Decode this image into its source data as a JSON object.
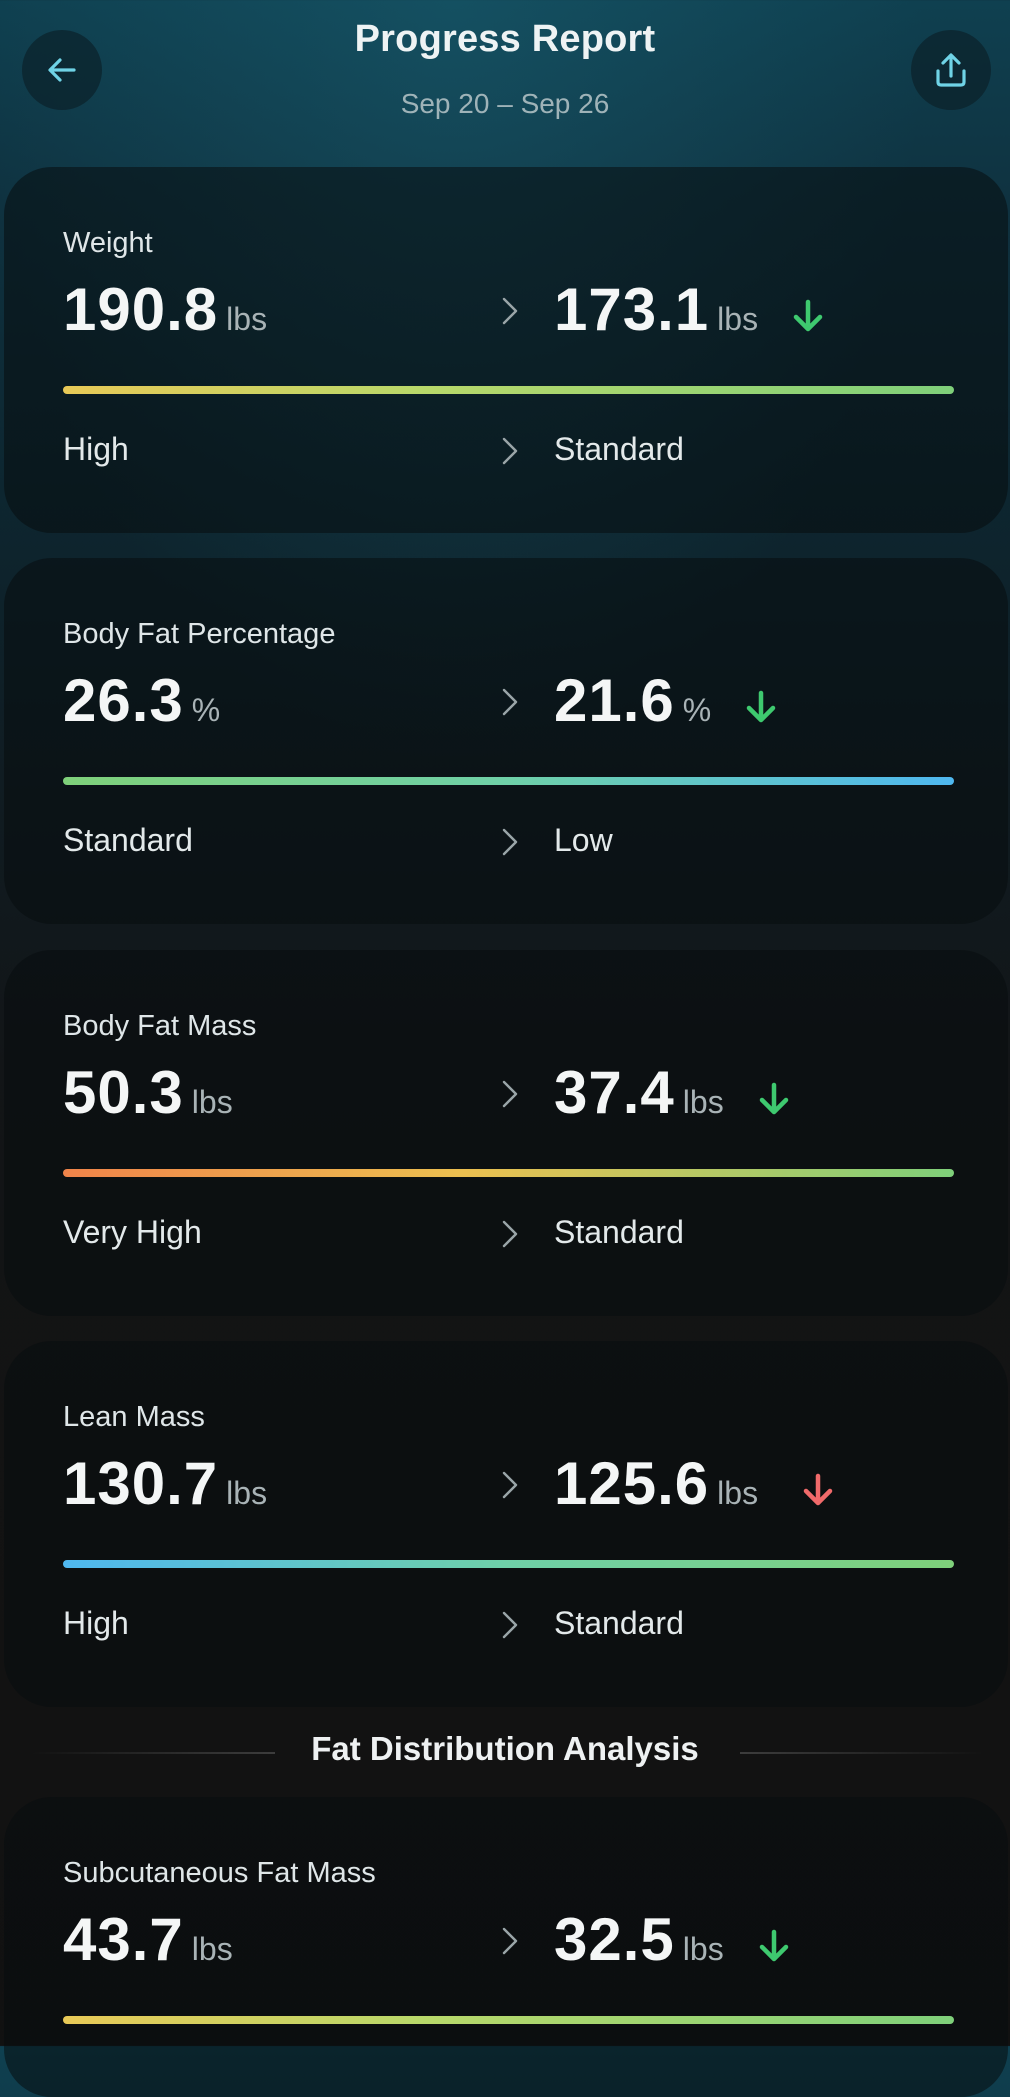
{
  "header": {
    "title": "Progress Report",
    "date_range": "Sep 20 – Sep 26",
    "back_icon": "arrow-left-icon",
    "share_icon": "upload-icon"
  },
  "colors": {
    "accent_icon": "#6fd3e6",
    "down_good": "#3ec96f",
    "down_bad": "#f06a6a"
  },
  "metrics": [
    {
      "label": "Weight",
      "from_value": "190.8",
      "from_unit": "lbs",
      "to_value": "173.1",
      "to_unit": "lbs",
      "from_status": "High",
      "to_status": "Standard",
      "trend": "down",
      "trend_color": "#3ec96f"
    },
    {
      "label": "Body Fat Percentage",
      "from_value": "26.3",
      "from_unit": "%",
      "to_value": "21.6",
      "to_unit": "%",
      "from_status": "Standard",
      "to_status": "Low",
      "trend": "down",
      "trend_color": "#3ec96f"
    },
    {
      "label": "Body Fat Mass",
      "from_value": "50.3",
      "from_unit": "lbs",
      "to_value": "37.4",
      "to_unit": "lbs",
      "from_status": "Very High",
      "to_status": "Standard",
      "trend": "down",
      "trend_color": "#3ec96f"
    },
    {
      "label": "Lean Mass",
      "from_value": "130.7",
      "from_unit": "lbs",
      "to_value": "125.6",
      "to_unit": "lbs",
      "from_status": "High",
      "to_status": "Standard",
      "trend": "down",
      "trend_color": "#f06a6a"
    }
  ],
  "section": {
    "title": "Fat Distribution Analysis"
  },
  "fat_distribution": [
    {
      "label": "Subcutaneous Fat Mass",
      "from_value": "43.7",
      "from_unit": "lbs",
      "to_value": "32.5",
      "to_unit": "lbs",
      "trend": "down",
      "trend_color": "#3ec96f"
    }
  ]
}
